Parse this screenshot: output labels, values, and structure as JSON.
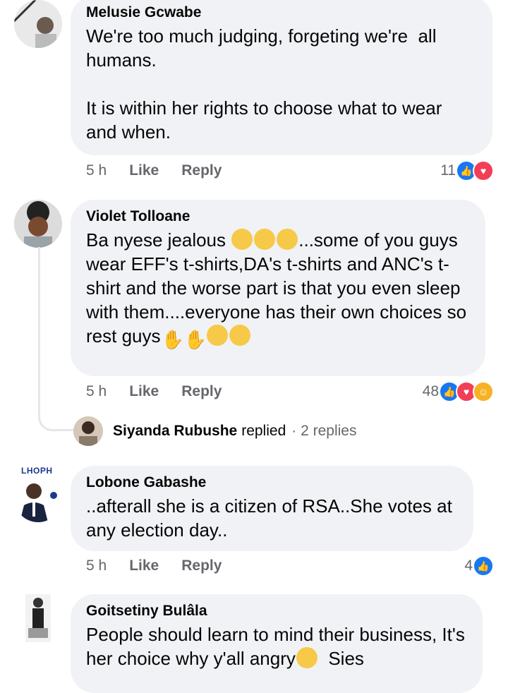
{
  "comments": [
    {
      "author": "Melusie Gcwabe",
      "text": "We're too much judging, forgeting we're  all humans.\n\nIt is within her rights to choose what to wear and when.",
      "time": "5 h",
      "like": "Like",
      "reply": "Reply",
      "reaction_count": "11",
      "reactions": [
        "like",
        "love"
      ]
    },
    {
      "author": "Violet Tolloane",
      "text_parts": [
        "Ba nyese jealous ",
        "...some of you guys wear EFF's t-shirts,DA's t-shirts and ANC's t-shirt and the worse part is that you even sleep with them....everyone has their own choices so rest guys"
      ],
      "time": "5 h",
      "like": "Like",
      "reply": "Reply",
      "reaction_count": "48",
      "reactions": [
        "like",
        "love",
        "haha"
      ],
      "reply_summary": {
        "name": "Siyanda Rubushe",
        "word": "replied",
        "count": "· 2 replies"
      }
    },
    {
      "author": "Lobone Gabashe",
      "avatar_tag": "LHOPH",
      "text": "..afterall she is a citizen of RSA..She votes at any election day..",
      "time": "5 h",
      "like": "Like",
      "reply": "Reply",
      "reaction_count": "4",
      "reactions": [
        "like"
      ]
    },
    {
      "author": "Goitsetiny Bulâla",
      "text_parts": [
        "People should learn to mind their business, It's her choice why y'all angry",
        "  Sies"
      ]
    }
  ],
  "colors": {
    "bubble": "#f0f2f5",
    "meta": "#65676b",
    "like": "#1877f2",
    "love": "#f33e58",
    "haha": "#f7b125"
  }
}
